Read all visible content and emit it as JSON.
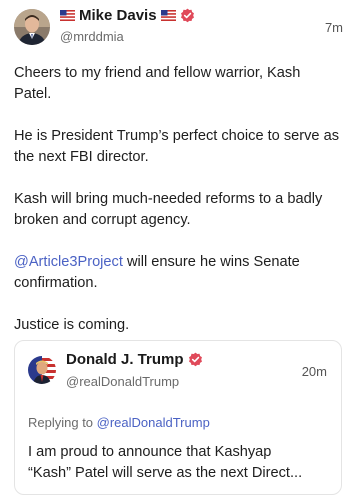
{
  "post": {
    "author": {
      "name": "Mike Davis",
      "handle": "@mrddmia",
      "flag_icon": "us-flag-icon",
      "verified_icon": "verified-badge-icon",
      "verified_color": "#e04a5a"
    },
    "timestamp": "7m",
    "body": {
      "p1": "Cheers to my friend and fellow warrior, Kash Patel.",
      "p2": "He is President Trump’s perfect choice to serve as the next FBI director.",
      "p3": "Kash will bring much-needed reforms to a badly broken and corrupt agency.",
      "p4_mention": "@Article3Project",
      "p4_rest": " will ensure he wins Senate confirmation.",
      "p5": "Justice is coming."
    },
    "mention_color": "#4b62c4"
  },
  "quoted_post": {
    "author": {
      "name": "Donald J. Trump",
      "handle": "@realDonaldTrump",
      "verified_icon": "verified-badge-icon"
    },
    "timestamp": "20m",
    "reply_prefix": "Replying to ",
    "reply_mention": "@realDonaldTrump",
    "text_line1": "I am proud to announce that Kashyap",
    "text_line2": "“Kash” Patel will serve as the next Direct..."
  }
}
